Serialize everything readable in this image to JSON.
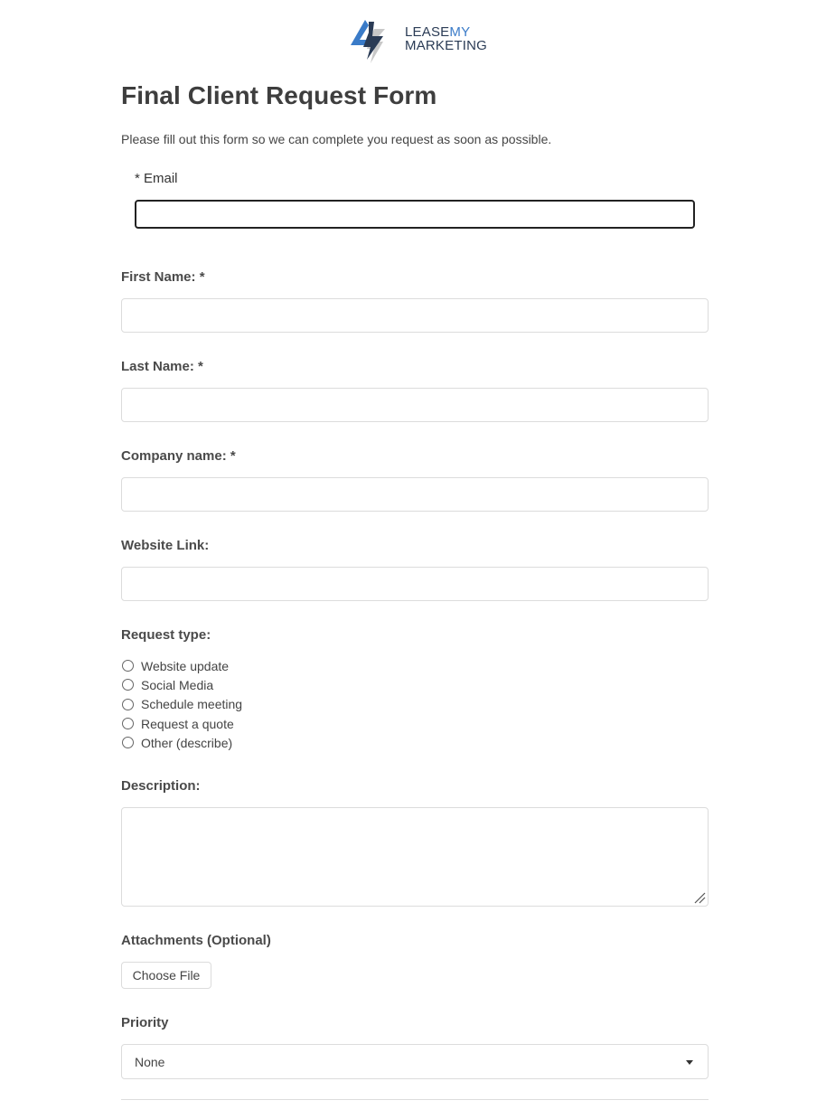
{
  "brand": {
    "name_part1": "LEASE",
    "name_part2": "MY",
    "name_line2": "MARKETING",
    "colors": {
      "dark": "#2a3b55",
      "accent": "#3a7bc8",
      "gray": "#c8c8c8"
    }
  },
  "form": {
    "title": "Final Client Request Form",
    "intro": "Please fill out this form so we can complete you request as soon as possible.",
    "email": {
      "label": "* Email",
      "value": ""
    },
    "first_name": {
      "label": "First Name: *",
      "value": ""
    },
    "last_name": {
      "label": "Last Name: *",
      "value": ""
    },
    "company": {
      "label": "Company name: *",
      "value": ""
    },
    "website": {
      "label": "Website Link:",
      "value": ""
    },
    "request_type": {
      "label": "Request type:",
      "options": [
        {
          "label": "Website update",
          "checked": false
        },
        {
          "label": "Social Media",
          "checked": false
        },
        {
          "label": "Schedule meeting",
          "checked": false
        },
        {
          "label": "Request a quote",
          "checked": false
        },
        {
          "label": "Other (describe)",
          "checked": false
        }
      ]
    },
    "description": {
      "label": "Description:",
      "value": ""
    },
    "attachments": {
      "label": "Attachments (Optional)",
      "button": "Choose File"
    },
    "priority": {
      "label": "Priority",
      "selected": "None"
    }
  }
}
